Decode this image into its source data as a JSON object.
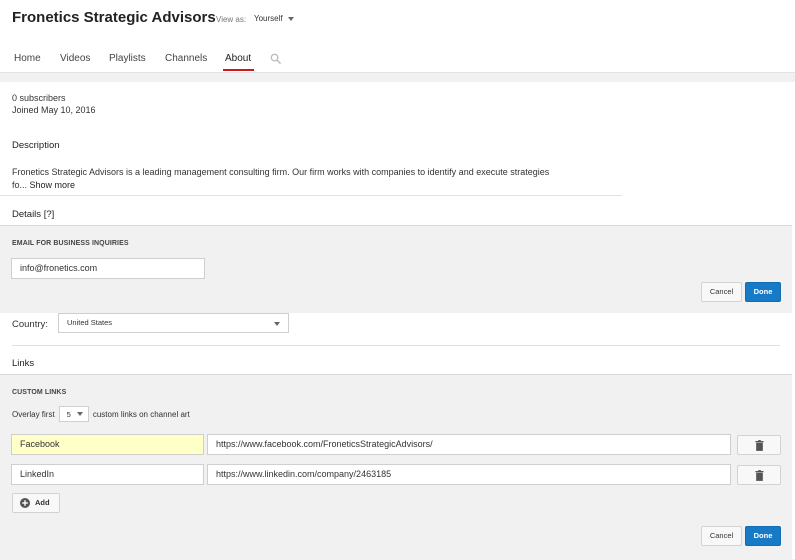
{
  "header": {
    "channel_title": "Fronetics Strategic Advisors",
    "view_as_label": "View as:",
    "view_as_value": "Yourself",
    "tabs": [
      {
        "label": "Home"
      },
      {
        "label": "Videos"
      },
      {
        "label": "Playlists"
      },
      {
        "label": "Channels"
      },
      {
        "label": "About"
      }
    ],
    "active_tab": "About",
    "accent_color": "#cc181e"
  },
  "stats": {
    "subscribers": "0 subscribers",
    "joined": "Joined May 10, 2016"
  },
  "description": {
    "title": "Description",
    "line1": "Fronetics Strategic Advisors is a leading management consulting firm. Our firm works with companies to identify and execute strategies",
    "line2": "fo...",
    "show_more": "Show more"
  },
  "details": {
    "title": "Details",
    "help": "[?]",
    "email_label": "EMAIL FOR BUSINESS INQUIRIES",
    "email_value": "info@fronetics.com",
    "cancel_label": "Cancel",
    "done_label": "Done",
    "country_label": "Country:",
    "country_value": "United States"
  },
  "links": {
    "title": "Links",
    "custom_links_label": "CUSTOM LINKS",
    "overlay_prefix": "Overlay first",
    "overlay_count": "5",
    "overlay_suffix": "custom links on channel art",
    "items": [
      {
        "title": "Facebook",
        "url": "https://www.facebook.com/FroneticsStrategicAdvisors/"
      },
      {
        "title": "LinkedIn",
        "url": "https://www.linkedin.com/company/2463185"
      }
    ],
    "add_label": "Add",
    "cancel_label": "Cancel",
    "done_label": "Done"
  },
  "colors": {
    "primary_button": "#167ac6",
    "highlight_field": "#ffffc8"
  }
}
